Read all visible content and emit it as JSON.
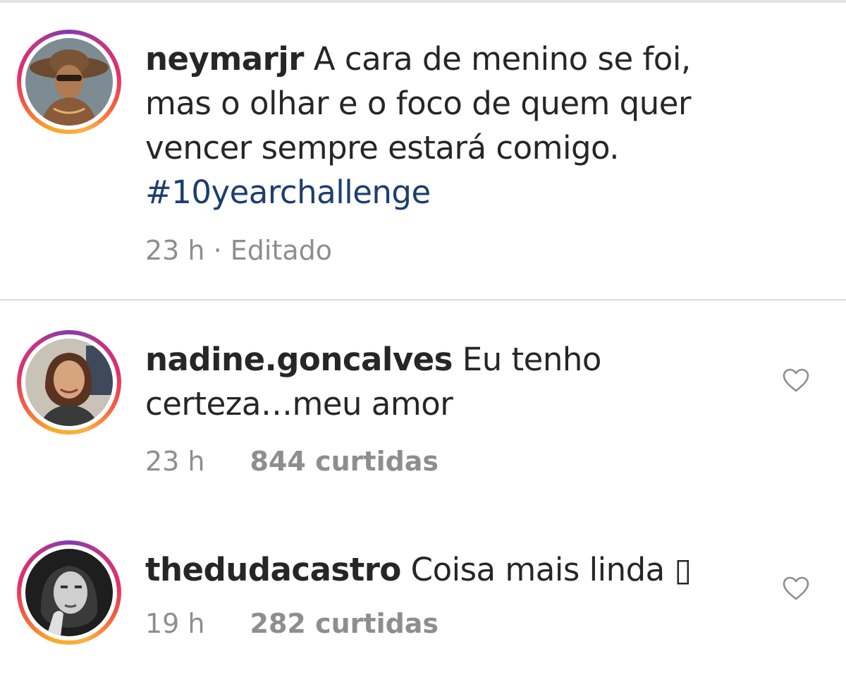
{
  "caption": {
    "username": "neymarjr",
    "text": " A cara de menino se foi, mas o olhar e o foco de quem quer vencer sempre estará comigo. ",
    "hashtag": "#10yearchallenge",
    "time": "23 h · Editado"
  },
  "comments": [
    {
      "username": "nadine.goncalves",
      "text": " Eu tenho certeza…meu amor",
      "time": "23 h",
      "likes": "844 curtidas",
      "icon": "heart-outline-icon"
    },
    {
      "username": "thedudacastro",
      "text": " Coisa mais linda ▯",
      "time": "19 h",
      "likes": "282 curtidas",
      "icon": "heart-outline-icon"
    }
  ],
  "colors": {
    "hashtag": "#1c3e6e",
    "meta": "#8e8e8e",
    "text": "#262626",
    "divider": "#dbdbdb"
  }
}
